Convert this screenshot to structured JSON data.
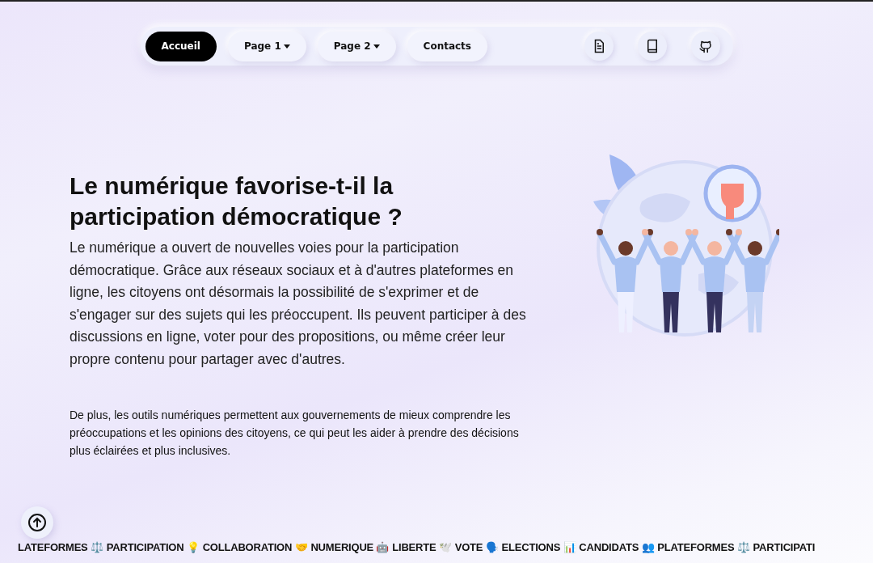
{
  "nav": {
    "items": [
      {
        "label": "Accueil",
        "kind": "link",
        "selected": true
      },
      {
        "label": "Page 1",
        "kind": "dropdown",
        "selected": false
      },
      {
        "label": "Page 2",
        "kind": "dropdown",
        "selected": false
      },
      {
        "label": "Contacts",
        "kind": "link",
        "selected": false
      }
    ],
    "icons": [
      {
        "kind": "document"
      },
      {
        "kind": "book"
      },
      {
        "kind": "cat"
      }
    ]
  },
  "hero": {
    "title": "Le numérique favorise-t-il la participation démocratique ?",
    "intro": "Le numérique a ouvert de nouvelles voies pour la participation démocratique. Grâce aux réseaux sociaux et à d'autres plateformes en ligne, les citoyens ont désormais la possibilité de s'exprimer et de s'engager sur des sujets qui les préoccupent. Ils peuvent participer à des discussions en ligne, voter pour des propositions, ou même créer leur propre contenu pour partager avec d'autres.",
    "detail": "De plus, les outils numériques permettent aux gouvernements de mieux comprendre les préoccupations et les opinions des citoyens, ce qui peut les aider à prendre des décisions plus éclairées et plus inclusives."
  },
  "marquee": [
    "LATEFORMES ⚖️",
    "PARTICIPATION 💡",
    "COLLABORATION 🤝",
    "NUMERIQUE 🤖",
    "LIBERTE 🕊️",
    "VOTE 🗣️",
    "ELECTIONS 📊",
    "CANDIDATS 👥",
    "PLATEFORMES ⚖️",
    "PARTICIPATI"
  ]
}
